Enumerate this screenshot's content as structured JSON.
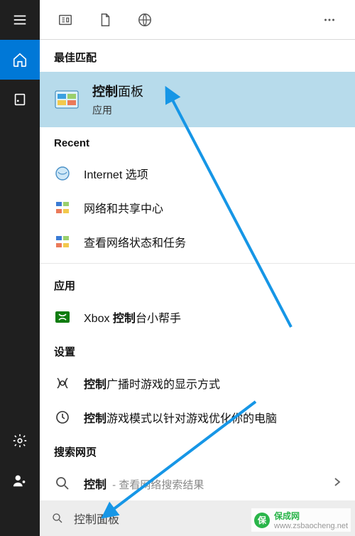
{
  "sidebar": {
    "items": [
      "menu",
      "home",
      "recent",
      "settings",
      "user"
    ]
  },
  "sections": {
    "best_match_header": "最佳匹配",
    "recent_header": "Recent",
    "apps_header": "应用",
    "settings_header": "设置",
    "web_header": "搜索网页"
  },
  "best_match": {
    "title_bold": "控制",
    "title_rest": "面板",
    "subtitle": "应用"
  },
  "recent": [
    {
      "label": "Internet 选项"
    },
    {
      "label": "网络和共享中心"
    },
    {
      "label": "查看网络状态和任务"
    }
  ],
  "apps": [
    {
      "prefix": "Xbox ",
      "bold": "控制",
      "suffix": "台小帮手"
    }
  ],
  "settings": [
    {
      "bold": "控制",
      "suffix": "广播时游戏的显示方式"
    },
    {
      "bold": "控制",
      "suffix": "游戏模式以针对游戏优化你的电脑"
    }
  ],
  "web": [
    {
      "bold": "控制",
      "sub": "查看网络搜索结果"
    }
  ],
  "search": {
    "value": "控制面板"
  },
  "watermark": {
    "brand": "保成网",
    "url": "www.zsbaocheng.net",
    "badge": "保"
  }
}
